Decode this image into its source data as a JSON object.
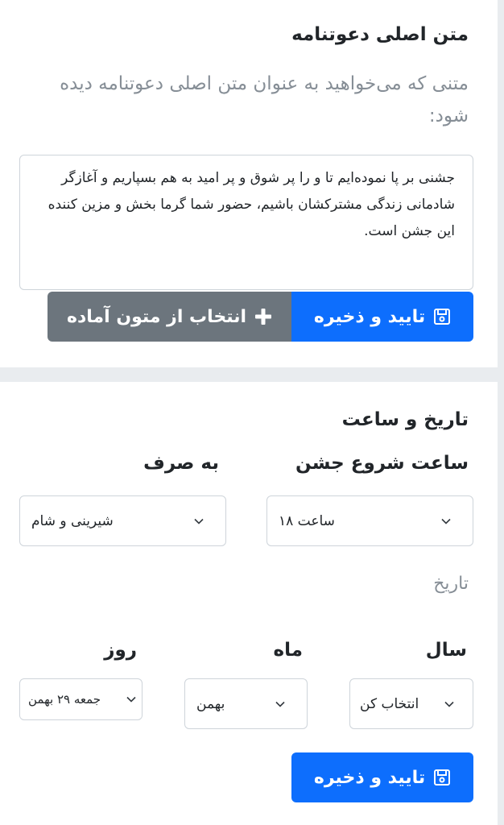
{
  "card1": {
    "title": "متن اصلی دعوتنامه",
    "description": "متنی که می‌خواهید به عنوان متن اصلی دعوتنامه دیده شود:",
    "textarea_value": "جشنی بر پا نموده‌ایم تا    و    را پر شوق و پر امید به هم بسپاریم و آغازگر شادمانی زندگی مشترکشان باشیم، حضور شما گرما بخش و مزین کننده این جشن است.",
    "save_label": "تایید و ذخیره",
    "templates_label": "انتخاب از متون آماده"
  },
  "card2": {
    "title": "تاریخ و ساعت",
    "start_time_label": "ساعت شروع جشن",
    "start_time_value": "ساعت ۱۸",
    "serving_label": "به صرف",
    "serving_value": "شیرینی و شام",
    "date_label": "تاریخ",
    "year_label": "سال",
    "year_value": "انتخاب کن",
    "month_label": "ماه",
    "month_value": "بهمن",
    "day_label": "روز",
    "day_value": "جمعه ۲۹ بهمن",
    "save_label": "تایید و ذخیره"
  },
  "colors": {
    "primary": "#0d6efd",
    "secondary": "#6c757d",
    "muted_text": "#868e96",
    "border": "#ced4da",
    "page_bg": "#e9ecef"
  },
  "icons": [
    "floppy-disk-icon",
    "plus-icon",
    "chevron-down-icon"
  ]
}
